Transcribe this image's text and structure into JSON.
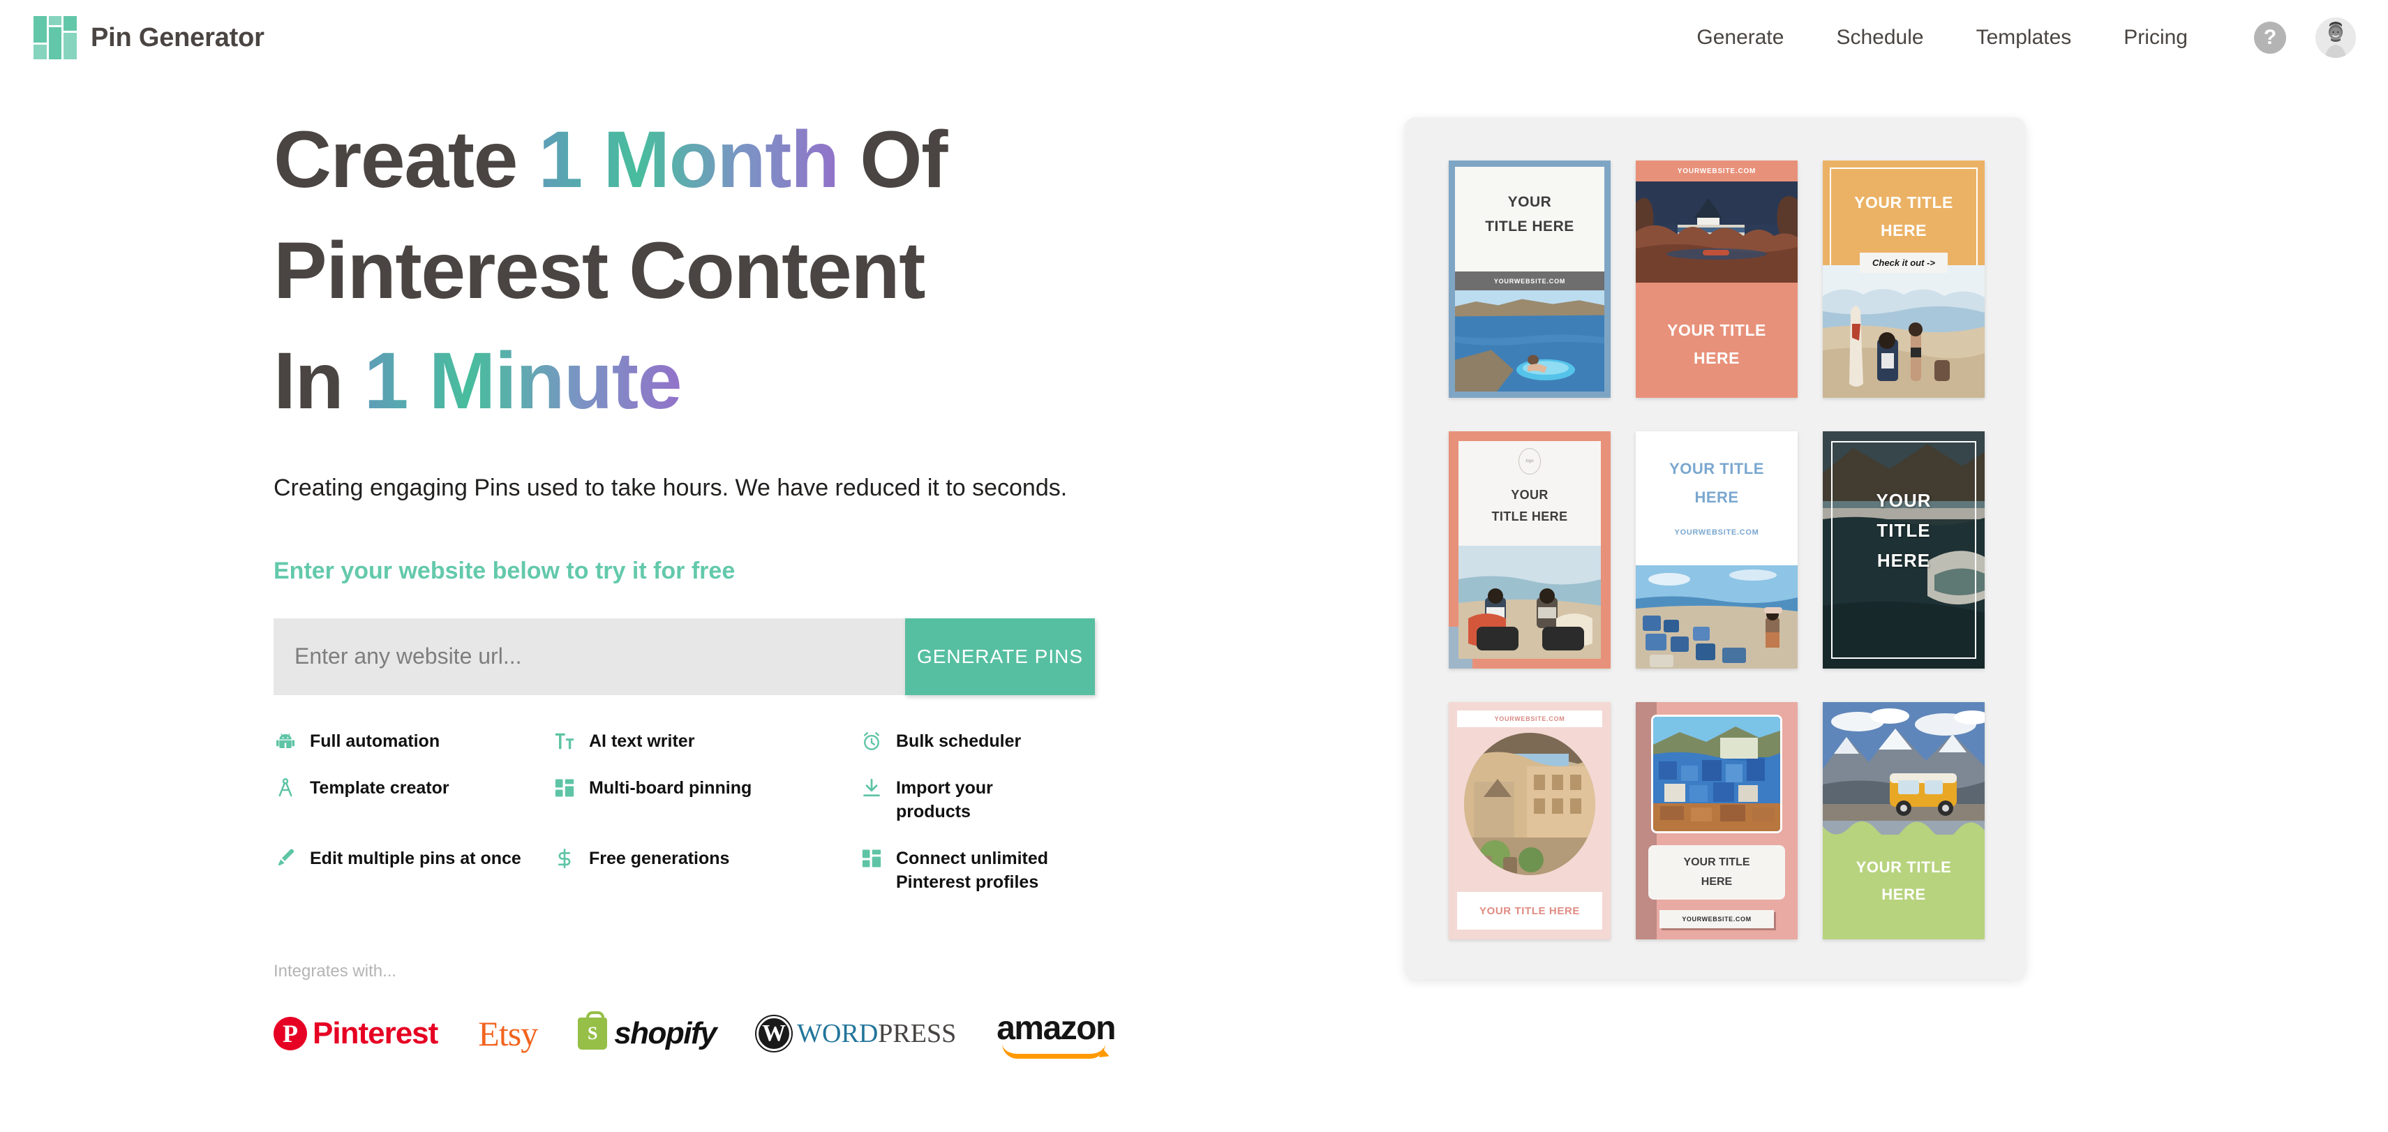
{
  "header": {
    "brand_name": "Pin Generator",
    "logo_icon": "grid-logo-icon",
    "nav": [
      {
        "label": "Generate"
      },
      {
        "label": "Schedule"
      },
      {
        "label": "Templates"
      },
      {
        "label": "Pricing"
      }
    ],
    "help_icon": "question-mark-icon",
    "help_label": "?",
    "avatar_icon": "user-avatar"
  },
  "hero": {
    "headline_line1_a": "Create ",
    "headline_line1_grad": "1 Month",
    "headline_line1_b": " Of",
    "headline_line2": "Pinterest Content",
    "headline_line3_a": "In ",
    "headline_line3_grad": "1 Minute",
    "subhead": "Creating engaging Pins used to take hours. We have reduced it to seconds.",
    "cta_label": "Enter your website below to try it for free",
    "input_placeholder": "Enter any website url...",
    "input_value": "",
    "button_label": "GENERATE PINS",
    "gradient": {
      "start": "#5f9db8",
      "mid": "#48bd9d",
      "mid2": "#7b94c4",
      "end": "#9272c9"
    },
    "accent_color": "#63c9ab",
    "button_color": "#57bfa1"
  },
  "features": [
    {
      "label": "Full automation",
      "icon": "robot-icon"
    },
    {
      "label": "AI text writer",
      "icon": "text-format-icon"
    },
    {
      "label": "Bulk scheduler",
      "icon": "alarm-clock-icon"
    },
    {
      "label": "Template creator",
      "icon": "compass-icon"
    },
    {
      "label": "Multi-board pinning",
      "icon": "grid-blocks-icon"
    },
    {
      "label": "Import your products",
      "icon": "download-icon"
    },
    {
      "label": "Edit multiple pins at once",
      "icon": "paintbrush-icon"
    },
    {
      "label": "Free generations",
      "icon": "dollar-sign-icon"
    },
    {
      "label": "Connect unlimited Pinterest profiles",
      "icon": "grid-blocks-icon"
    }
  ],
  "integrations": {
    "label": "Integrates with...",
    "logos": [
      {
        "name": "Pinterest",
        "icon": "pinterest-logo",
        "color": "#e60023"
      },
      {
        "name": "Etsy",
        "icon": "etsy-logo",
        "color": "#f1641e"
      },
      {
        "name": "shopify",
        "icon": "shopify-logo",
        "color": "#95bf47"
      },
      {
        "name": "WordPress",
        "icon": "wordpress-logo",
        "color": "#21759b"
      },
      {
        "name": "amazon",
        "icon": "amazon-logo",
        "color": "#ff9900"
      }
    ]
  },
  "preview_panel": {
    "pins": [
      {
        "id": 1,
        "title_line1": "YOUR",
        "title_line2": "TITLE HERE",
        "website": "YOURWEBSITE.COM",
        "accent": "#7fa5c4",
        "style": "blue-border-top-title"
      },
      {
        "id": 2,
        "title_line1": "YOUR TITLE",
        "title_line2": "HERE",
        "website": "YOURWEBSITE.COM",
        "accent": "#e8917a",
        "style": "coral-url-top"
      },
      {
        "id": 3,
        "title_line1": "YOUR TITLE",
        "title_line2": "HERE",
        "button": "Check it out ->",
        "accent": "#ebb265",
        "style": "amber-frame-cta"
      },
      {
        "id": 4,
        "title_line1": "YOUR",
        "title_line2": "TITLE HERE",
        "accent": "#e8917a",
        "style": "coral-border-seal"
      },
      {
        "id": 5,
        "title_line1": "YOUR TITLE",
        "title_line2": "HERE",
        "website": "YOURWEBSITE.COM",
        "accent": "#7aa7cf",
        "style": "white-blue-text"
      },
      {
        "id": 6,
        "title_line1": "YOUR",
        "title_line2": "TITLE",
        "title_line3": "HERE",
        "accent": "#1e2b2b",
        "style": "dark-overlay-frame"
      },
      {
        "id": 7,
        "title_line1": "YOUR TITLE HERE",
        "website": "YOURWEBSITE.COM",
        "accent": "#f3d8d4",
        "style": "pink-oval"
      },
      {
        "id": 8,
        "title_line1": "YOUR TITLE",
        "title_line2": "HERE",
        "website": "YOURWEBSITE.COM",
        "accent": "#e8aaa2",
        "style": "rose-card"
      },
      {
        "id": 9,
        "title_line1": "YOUR TITLE",
        "title_line2": "HERE",
        "accent": "#b7d37e",
        "style": "green-wave"
      }
    ]
  }
}
